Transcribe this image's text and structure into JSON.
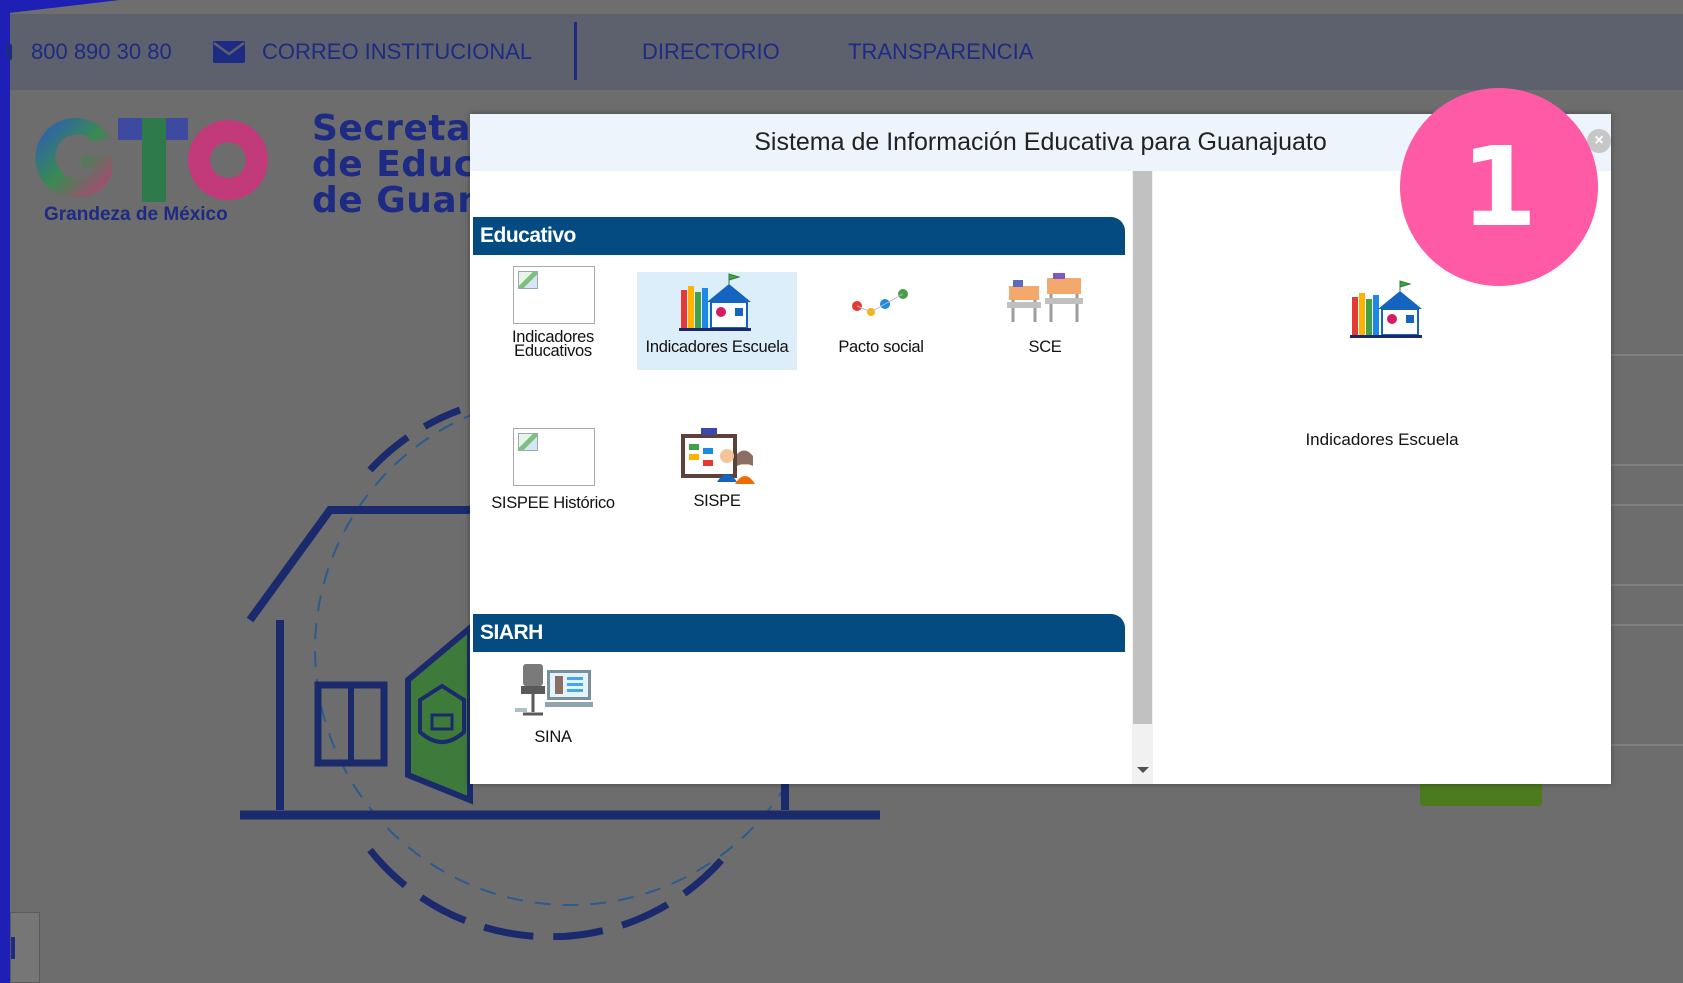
{
  "topbar": {
    "phone": "800 890 30 80",
    "email_link": "CORREO INSTITUCIONAL",
    "nav": [
      "DIRECTORIO",
      "TRANSPARENCIA"
    ]
  },
  "header": {
    "logo_text": "GTO",
    "tagline": "Grandeza de México",
    "secretaria_lines": [
      "Secretar",
      "de Educa",
      "de Guana"
    ]
  },
  "modal": {
    "title": "Sistema de Información Educativa para Guanajuato",
    "close_glyph": "×",
    "sections": [
      {
        "name": "Educativo",
        "apps": [
          {
            "label_line1": "Indicadores",
            "label_line2": "Educativos",
            "icon": "broken-image-icon",
            "selected": false
          },
          {
            "label_line1": "Indicadores Escuela",
            "label_line2": "",
            "icon": "school-house-icon",
            "selected": true
          },
          {
            "label_line1": "Pacto social",
            "label_line2": "",
            "icon": "pacto-dots-icon",
            "selected": false
          },
          {
            "label_line1": "SCE",
            "label_line2": "",
            "icon": "school-desks-icon",
            "selected": false
          },
          {
            "label_line1": "SISPEE Histórico",
            "label_line2": "",
            "icon": "broken-image-icon",
            "selected": false
          },
          {
            "label_line1": "SISPE",
            "label_line2": "",
            "icon": "teachers-board-icon",
            "selected": false
          }
        ]
      },
      {
        "name": "SIARH",
        "apps": [
          {
            "label_line1": "SINA",
            "label_line2": "",
            "icon": "office-desk-icon",
            "selected": false
          }
        ]
      }
    ],
    "preview": {
      "label": "Indicadores Escuela",
      "icon": "school-house-icon"
    }
  },
  "step_badge": "1",
  "colors": {
    "navy": "#1d2b84",
    "section_blue": "#044b82",
    "badge_pink": "#ff5aa6",
    "selected_bg": "#dceef9"
  }
}
